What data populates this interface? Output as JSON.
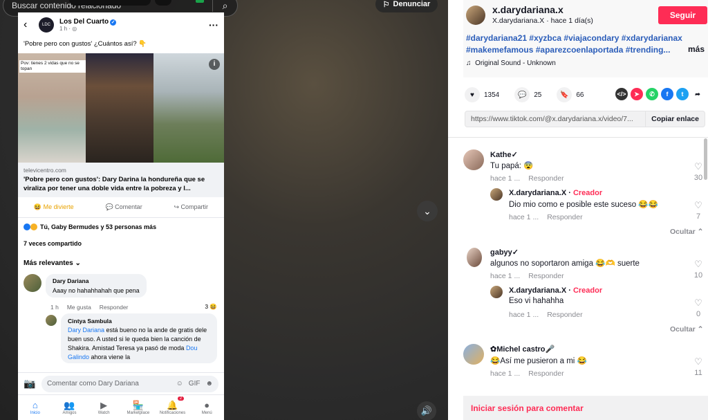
{
  "video": {
    "search_placeholder": "Buscar contenido relacionado",
    "report_label": "Denunciar"
  },
  "fb": {
    "page_name": "Los Del Cuarto",
    "time": "1 h · ",
    "post_text": "'Pobre pero con gustos' ¿Cuántos así? 👇",
    "photo_caption": "Pov: tienes 2 vidas que no se topan",
    "link_domain": "televicentro.com",
    "link_title": "'Pobre pero con gustos': Dary Darina la hondureña que se viraliza por tener una doble vida entre la pobreza y l...",
    "actions": {
      "react": "Me divierte",
      "comment": "Comentar",
      "share": "Compartir"
    },
    "reactions_text": "Tú, Gaby Bermudes y 53 personas más",
    "shares_text": "7 veces compartido",
    "relevant_label": "Más relevantes",
    "comment1": {
      "name": "Dary Dariana",
      "text": "Aaay no hahahhahah que pena",
      "time": "1 h",
      "like": "Me gusta",
      "reply": "Responder",
      "count": "3"
    },
    "comment2": {
      "name": "Cintya Sambula",
      "mention": "Dary Dariana",
      "text": " está bueno no la ande de gratis dele buen uso. A usted si le queda bien la canción de Shakira. Amistad Teresa ya pasó de moda ",
      "mention2": "Dou Galindo",
      "text2": " ahora viene la"
    },
    "input_placeholder": "Comentar como Dary Dariana",
    "tabs": [
      {
        "label": "Inicio",
        "icon": "⌂"
      },
      {
        "label": "Amigos",
        "icon": "👥"
      },
      {
        "label": "Watch",
        "icon": "▶"
      },
      {
        "label": "Marketplace",
        "icon": "🏪"
      },
      {
        "label": "Notificaciones",
        "icon": "🔔",
        "badge": "2"
      },
      {
        "label": "Menú",
        "icon": "●"
      }
    ]
  },
  "tiktok": {
    "username": "x.darydariana.x",
    "subline": "X.darydariana.X · hace 1 día(s)",
    "follow": "Seguir",
    "hashtags": "#darydariana21 #xyzbca #viajacondary #xdarydarianax #makemefamous #aparezcoenlaportada #trending...",
    "more": "más",
    "sound": "Original Sound - Unknown",
    "likes": "1354",
    "comments": "25",
    "saves": "66",
    "url": "https://www.tiktok.com/@x.darydariana.x/video/7...",
    "copy": "Copiar enlace",
    "login": "Iniciar sesión para comentar",
    "hide": "Ocultar",
    "creator_label": "Creador",
    "comment_list": [
      {
        "name": "Kathe",
        "text": "Tu papá: 😨",
        "meta": "hace 1 ...",
        "reply": "Responder",
        "likes": "30"
      },
      {
        "name": "X.darydariana.X",
        "text": "Dio mio como e posible este suceso 😂😂",
        "meta": "hace 1 ...",
        "reply": "Responder",
        "likes": "7"
      },
      {
        "name": "gabyy",
        "text": "algunos no soportaron amiga 😂🫶 suerte",
        "meta": "hace 1 ...",
        "reply": "Responder",
        "likes": "10"
      },
      {
        "name": "X.darydariana.X",
        "text": "Eso vi hahahha",
        "meta": "hace 1 ...",
        "reply": "Responder",
        "likes": "0"
      },
      {
        "name": "✿Michel  castro",
        "text": "😂Así me pusieron a mi 😂",
        "meta": "hace 1 ...",
        "reply": "Responder",
        "likes": "11"
      }
    ]
  }
}
